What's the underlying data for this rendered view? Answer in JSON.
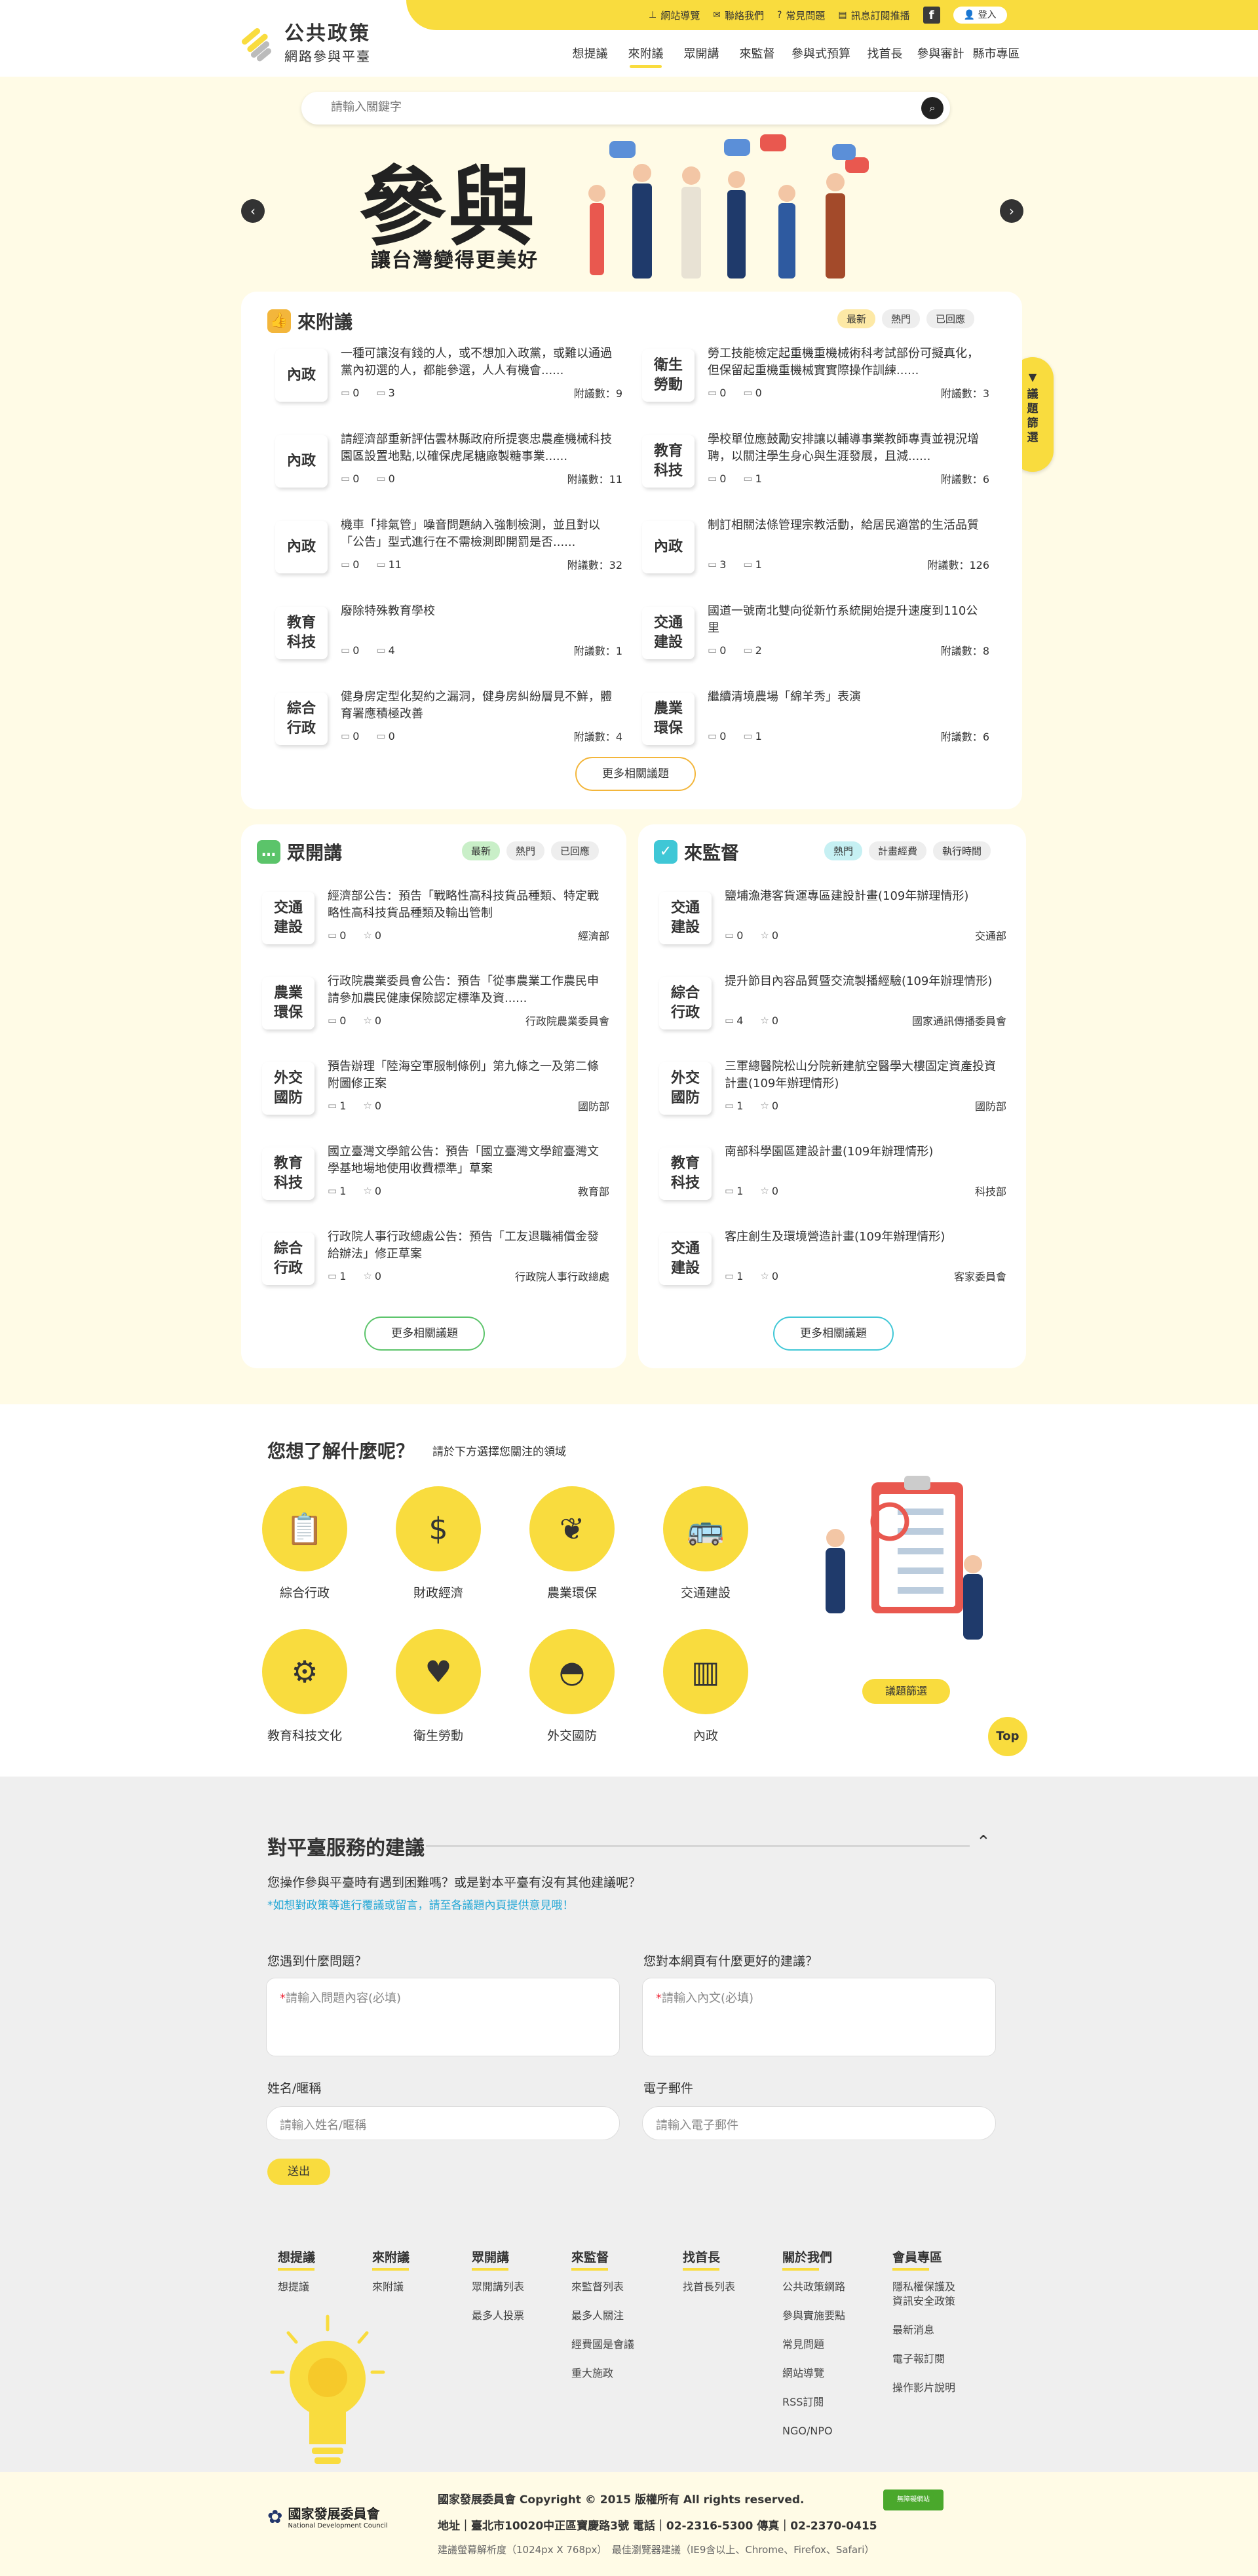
{
  "header": {
    "logo_title": "公共政策",
    "logo_sub": "網路參與平臺",
    "toplinks": [
      {
        "label": "網站導覽",
        "icon": "sitemap-icon"
      },
      {
        "label": "聯絡我們",
        "icon": "mail-icon"
      },
      {
        "label": "常見問題",
        "icon": "question-icon"
      },
      {
        "label": "訊息訂閱推播",
        "icon": "subscribe-icon"
      }
    ],
    "fb": "f",
    "login": "登入",
    "nav": [
      "想提議",
      "來附議",
      "眾開講",
      "來監督",
      "參與式預算",
      "找首長",
      "參與審計",
      "縣市專區"
    ],
    "active_nav": "來附議"
  },
  "search": {
    "placeholder": "請輸入關鍵字"
  },
  "hero": {
    "big": "參與",
    "sub": "讓台灣變得更美好"
  },
  "side_button": "議題篩選",
  "fuyi": {
    "title": "來附議",
    "filters": [
      "最新",
      "熱門",
      "已回應"
    ],
    "count_label": "附議數：",
    "items": [
      {
        "cat": "內政",
        "title": "一種可讓沒有錢的人，或不想加入政黨，或難以通過黨內初選的人，都能參選，人人有機會......",
        "comments": "0",
        "likes": "3",
        "count": "9"
      },
      {
        "cat": "衛生勞動",
        "title": "勞工技能檢定起重機重機械術科考試部份可擬真化，但保留起重機重機械實實際操作訓練......",
        "comments": "0",
        "likes": "0",
        "count": "3"
      },
      {
        "cat": "內政",
        "title": "請經濟部重新評估雲林縣政府所提褒忠農產機械科技園區設置地點,以確保虎尾糖廠製糖事業......",
        "comments": "0",
        "likes": "0",
        "count": "11"
      },
      {
        "cat": "教育科技",
        "title": "學校單位應鼓勵安排讓以輔導事業教師專責並視況增聘，以關注學生身心與生涯發展，且減......",
        "comments": "0",
        "likes": "1",
        "count": "6"
      },
      {
        "cat": "內政",
        "title": "機車「排氣管」噪音問題納入強制檢測，並且對以「公告」型式進行在不需檢測即開罰是否......",
        "comments": "0",
        "likes": "11",
        "count": "32"
      },
      {
        "cat": "內政",
        "title": "制訂相關法條管理宗教活動，給居民適當的生活品質",
        "comments": "3",
        "likes": "1",
        "count": "126"
      },
      {
        "cat": "教育科技",
        "title": "廢除特殊教育學校",
        "comments": "0",
        "likes": "4",
        "count": "1"
      },
      {
        "cat": "交通建設",
        "title": "國道一號南北雙向從新竹系統開始提升速度到110公里",
        "comments": "0",
        "likes": "2",
        "count": "8"
      },
      {
        "cat": "綜合行政",
        "title": "健身房定型化契約之漏洞，健身房糾紛層見不鮮，體育署應積極改善",
        "comments": "0",
        "likes": "0",
        "count": "4"
      },
      {
        "cat": "農業環保",
        "title": "繼續清境農場「綿羊秀」表演",
        "comments": "0",
        "likes": "1",
        "count": "6"
      }
    ],
    "more": "更多相關議題"
  },
  "zhong": {
    "title": "眾開講",
    "filters": [
      "最新",
      "熱門",
      "已回應"
    ],
    "items": [
      {
        "cat": "交通建設",
        "title": "經濟部公告：預告「戰略性高科技貨品種類、特定戰略性高科技貨品種類及輸出管制",
        "comments": "0",
        "likes": "0",
        "org": "經濟部"
      },
      {
        "cat": "農業環保",
        "title": "行政院農業委員會公告：預告「從事農業工作農民申請參加農民健康保險認定標準及資......",
        "comments": "0",
        "likes": "0",
        "org": "行政院農業委員會"
      },
      {
        "cat": "外交國防",
        "title": "預告辦理「陸海空軍服制條例」第九條之一及第二條附圖修正案",
        "comments": "1",
        "likes": "0",
        "org": "國防部"
      },
      {
        "cat": "教育科技",
        "title": "國立臺灣文學館公告：預告「國立臺灣文學館臺灣文學基地場地使用收費標準」草案",
        "comments": "1",
        "likes": "0",
        "org": "教育部"
      },
      {
        "cat": "綜合行政",
        "title": "行政院人事行政總處公告：預告「工友退職補償金發給辦法」修正草案",
        "comments": "1",
        "likes": "0",
        "org": "行政院人事行政總處"
      }
    ],
    "more": "更多相關議題"
  },
  "jiandu": {
    "title": "來監督",
    "filters": [
      "熱門",
      "計畫經費",
      "執行時間"
    ],
    "items": [
      {
        "cat": "交通建設",
        "title": "鹽埔漁港客貨運專區建設計畫(109年辦理情形)",
        "comments": "0",
        "likes": "0",
        "org": "交通部"
      },
      {
        "cat": "綜合行政",
        "title": "提升節目內容品質暨交流製播經驗(109年辦理情形)",
        "comments": "4",
        "likes": "0",
        "org": "國家通訊傳播委員會"
      },
      {
        "cat": "外交國防",
        "title": "三軍總醫院松山分院新建航空醫學大樓固定資產投資計畫(109年辦理情形)",
        "comments": "1",
        "likes": "0",
        "org": "國防部"
      },
      {
        "cat": "教育科技",
        "title": "南部科學園區建設計畫(109年辦理情形)",
        "comments": "1",
        "likes": "0",
        "org": "科技部"
      },
      {
        "cat": "交通建設",
        "title": "客庄創生及環境營造計畫(109年辦理情形)",
        "comments": "1",
        "likes": "0",
        "org": "客家委員會"
      }
    ],
    "more": "更多相關議題"
  },
  "topics": {
    "title": "您想了解什麼呢？",
    "sub": "請於下方選擇您關注的領域",
    "items": [
      {
        "label": "綜合行政",
        "icon": "clipboard-icon"
      },
      {
        "label": "財政經濟",
        "icon": "finance-chart-icon"
      },
      {
        "label": "農業環保",
        "icon": "plant-icon"
      },
      {
        "label": "交通建設",
        "icon": "bus-icon"
      },
      {
        "label": "教育科技文化",
        "icon": "robot-icon"
      },
      {
        "label": "衛生勞動",
        "icon": "heart-hands-icon"
      },
      {
        "label": "外交國防",
        "icon": "helmet-icon"
      },
      {
        "label": "內政",
        "icon": "building-icon"
      }
    ],
    "button": "議題篩選",
    "top": "Top"
  },
  "feedback": {
    "title": "對平臺服務的建議",
    "question": "您操作參與平臺時有遇到困難嗎？或是對本平臺有沒有其他建議呢？",
    "note": "*如想對政策等進行覆議或留言，請至各議題內頁提供意見哦！",
    "label1": "您遇到什麼問題？",
    "label2": "您對本網頁有什麼更好的建議？",
    "ph1": "請輸入問題內容(必填)",
    "ph2": "請輸入內文(必填)",
    "label_name": "姓名/暱稱",
    "label_email": "電子郵件",
    "ph_name": "請輸入姓名/暱稱",
    "ph_email": "請輸入電子郵件",
    "submit": "送出"
  },
  "footer_nav": [
    {
      "head": "想提議",
      "links": [
        "想提議"
      ]
    },
    {
      "head": "來附議",
      "links": [
        "來附議"
      ]
    },
    {
      "head": "眾開講",
      "links": [
        "眾開講列表",
        "最多人投票"
      ]
    },
    {
      "head": "來監督",
      "links": [
        "來監督列表",
        "最多人關注",
        "經費國是會議",
        "重大施政"
      ]
    },
    {
      "head": "找首長",
      "links": [
        "找首長列表"
      ]
    },
    {
      "head": "關於我們",
      "links": [
        "公共政策網路",
        "參與實施要點",
        "常見問題",
        "網站導覽",
        "RSS訂閱",
        "NGO/NPO"
      ]
    },
    {
      "head": "會員專區",
      "links": [
        "隱私權保護及資訊安全政策",
        "最新消息",
        "電子報訂閱",
        "操作影片說明"
      ]
    }
  ],
  "footer": {
    "org": "國家發展委員會",
    "org_en": "National Development Council",
    "copyright": "國家發展委員會 Copyright © 2015 版權所有 All rights reserved.",
    "address": "地址｜臺北市10020中正區寶慶路3號 電話｜02-2316-5300 傳真｜02-2370-0415",
    "browser": "建議螢幕解析度（1024px X 768px）　最佳瀏覽器建議（IE9含以上、Chrome、Firefox、Safari）",
    "badge": "無障礙網站"
  },
  "colors": {
    "brand_yellow": "#f9dc3e",
    "bg_cream": "#fffbe6",
    "green": "#5bc46a",
    "cyan": "#3fc7d6",
    "link_blue": "#23a7d6"
  }
}
